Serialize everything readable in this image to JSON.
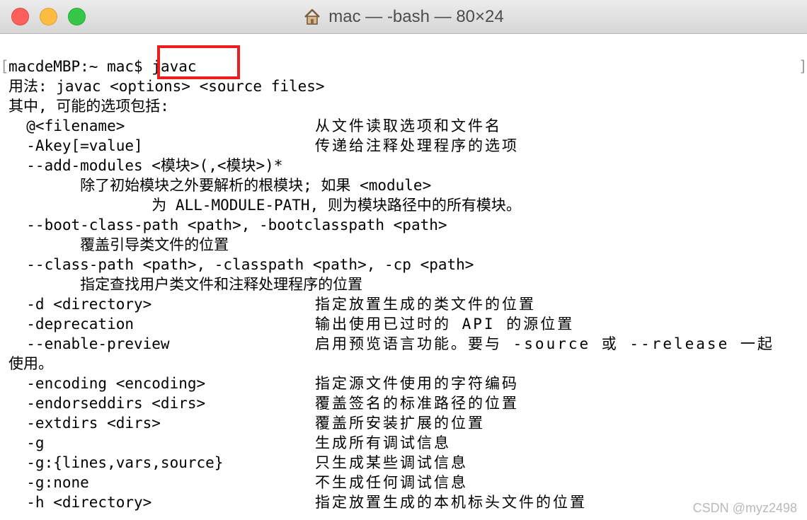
{
  "window": {
    "title": "mac — -bash — 80×24",
    "icon": "home-icon"
  },
  "prompt": {
    "text": "macdeMBP:~ mac$ ",
    "command": "javac"
  },
  "lines": [
    {
      "text": "用法: javac <options> <source files>"
    },
    {
      "text": "其中, 可能的选项包括:"
    },
    {
      "text": "  @<filename>",
      "desc": "从文件读取选项和文件名"
    },
    {
      "text": "  -Akey[=value]",
      "desc": "传递给注释处理程序的选项"
    },
    {
      "text": "  --add-modules <模块>(,<模块>)*"
    },
    {
      "text": "        除了初始模块之外要解析的根模块; 如果 <module>"
    },
    {
      "text": "                为 ALL-MODULE-PATH, 则为模块路径中的所有模块。"
    },
    {
      "text": "  --boot-class-path <path>, -bootclasspath <path>"
    },
    {
      "text": "        覆盖引导类文件的位置"
    },
    {
      "text": "  --class-path <path>, -classpath <path>, -cp <path>"
    },
    {
      "text": "        指定查找用户类文件和注释处理程序的位置"
    },
    {
      "text": "  -d <directory>",
      "desc": "指定放置生成的类文件的位置"
    },
    {
      "text": "  -deprecation",
      "desc": "输出使用已过时的 API 的源位置"
    },
    {
      "text": "  --enable-preview",
      "desc": "启用预览语言功能。要与 -source 或 --release 一起"
    },
    {
      "text": "使用。"
    },
    {
      "text": "  -encoding <encoding>",
      "desc": "指定源文件使用的字符编码"
    },
    {
      "text": "  -endorseddirs <dirs>",
      "desc": "覆盖签名的标准路径的位置"
    },
    {
      "text": "  -extdirs <dirs>",
      "desc": "覆盖所安装扩展的位置"
    },
    {
      "text": "  -g",
      "desc": "生成所有调试信息"
    },
    {
      "text": "  -g:{lines,vars,source}",
      "desc": "只生成某些调试信息"
    },
    {
      "text": "  -g:none",
      "desc": "不生成任何调试信息"
    },
    {
      "text": "  -h <directory>",
      "desc": "指定放置生成的本机标头文件的位置"
    }
  ],
  "watermark": "CSDN @myz2498",
  "colors": {
    "highlight": "#ee1c1c",
    "close": "#fc605c",
    "minimize": "#fdbc40",
    "zoom": "#34c749"
  }
}
